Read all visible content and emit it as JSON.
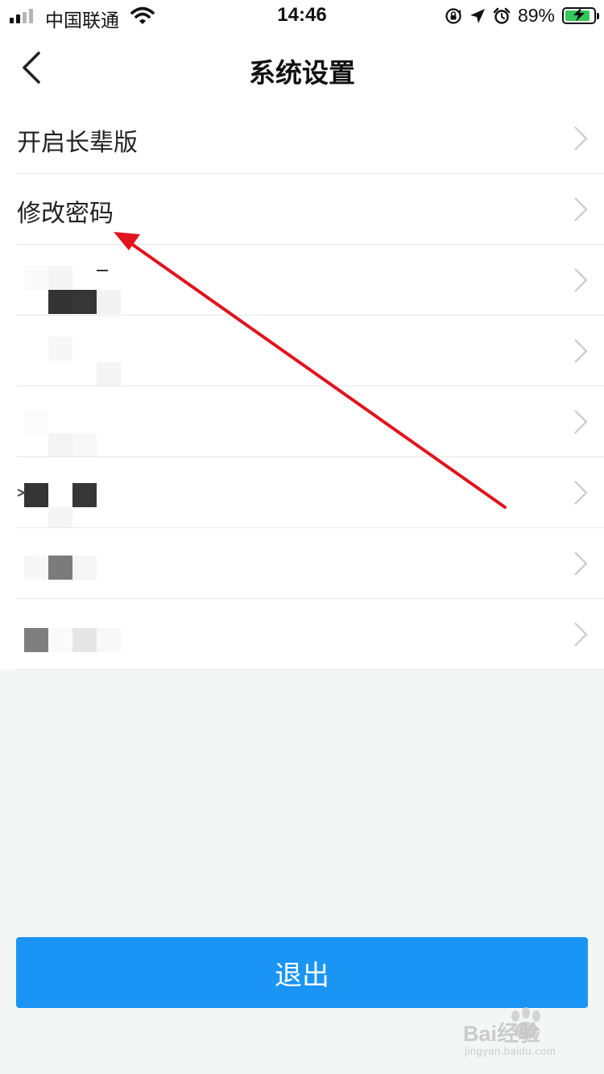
{
  "status_bar": {
    "carrier": "中国联通",
    "time": "14:46",
    "battery_percent": "89%",
    "battery_level": 0.89,
    "icons": [
      "signal-icon",
      "wifi-icon",
      "rotation-lock-icon",
      "location-icon",
      "alarm-icon",
      "battery-icon"
    ]
  },
  "header": {
    "title": "系统设置",
    "back_icon": "chevron-left-icon"
  },
  "settings": {
    "items": [
      {
        "label": "开启长辈版"
      },
      {
        "label": "修改密码"
      }
    ],
    "chevron_icon": "chevron-right-icon"
  },
  "footer": {
    "logout_label": "退出"
  },
  "watermark": {
    "brand": "Bai经验",
    "sub": "jingyan.baidu.com"
  },
  "colors": {
    "primary": "#1a94f5",
    "annotation_arrow": "#e0141e",
    "page_background": "#f4f6f6",
    "battery_fill": "#34c759"
  }
}
